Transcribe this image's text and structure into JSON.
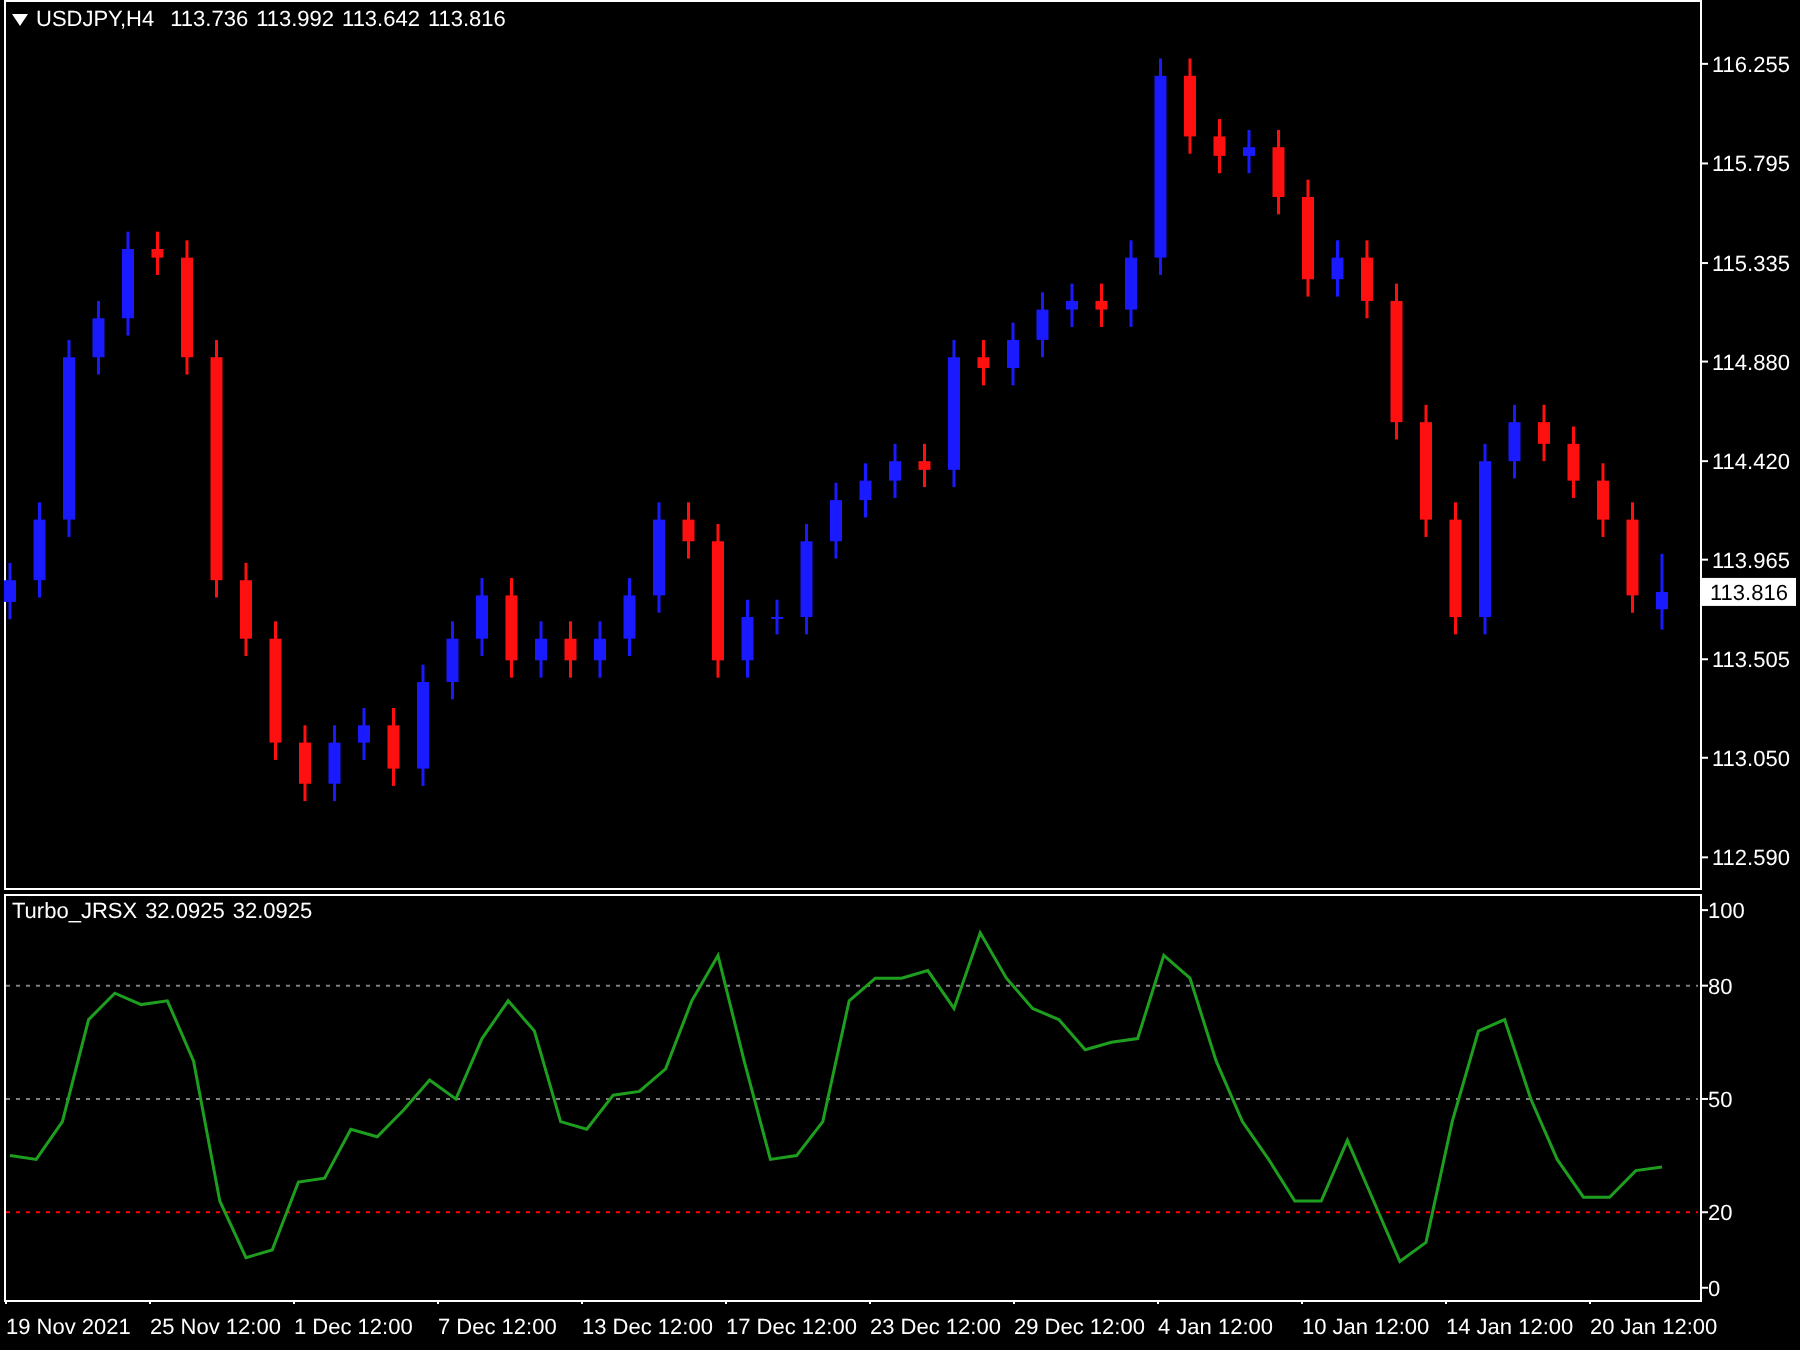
{
  "price_chart": {
    "symbol": "USDJPY,H4",
    "ohlc": [
      "113.736",
      "113.992",
      "113.642",
      "113.816"
    ],
    "current_price": "113.816",
    "chart_data": {
      "type": "candlestick",
      "categories": [
        null,
        null,
        null,
        null,
        null,
        null,
        null,
        null,
        null,
        null,
        null,
        null,
        null,
        null,
        null,
        null,
        null,
        null,
        null,
        null,
        null,
        null,
        null,
        null,
        null,
        null,
        null,
        null,
        null,
        null,
        null,
        null,
        null,
        null,
        null,
        null,
        null,
        null,
        null,
        null,
        null,
        null,
        null,
        null,
        null,
        null,
        null,
        null,
        null,
        null,
        null,
        null,
        null,
        null,
        null,
        null,
        null
      ],
      "ylim": [
        112.43,
        116.55
      ],
      "yticks": [
        {
          "value": 116.255,
          "label": "116.255"
        },
        {
          "value": 115.795,
          "label": "115.795"
        },
        {
          "value": 115.335,
          "label": "115.335"
        },
        {
          "value": 114.88,
          "label": "114.880"
        },
        {
          "value": 114.42,
          "label": "114.420"
        },
        {
          "value": 113.965,
          "label": "113.965"
        },
        {
          "value": 113.505,
          "label": "113.505"
        },
        {
          "value": 113.05,
          "label": "113.050"
        },
        {
          "value": 112.59,
          "label": "112.590"
        }
      ],
      "ohlc": [
        [
          113.77,
          113.95,
          113.69,
          113.87
        ],
        [
          113.87,
          114.23,
          113.79,
          114.15
        ],
        [
          114.15,
          114.98,
          114.07,
          114.9
        ],
        [
          114.9,
          115.16,
          114.82,
          115.08
        ],
        [
          115.08,
          115.48,
          115.0,
          115.4
        ],
        [
          115.4,
          115.48,
          115.28,
          115.36
        ],
        [
          115.36,
          115.44,
          114.82,
          114.9
        ],
        [
          114.9,
          114.98,
          113.79,
          113.87
        ],
        [
          113.87,
          113.95,
          113.52,
          113.6
        ],
        [
          113.6,
          113.68,
          113.04,
          113.12
        ],
        [
          113.12,
          113.2,
          112.85,
          112.93
        ],
        [
          112.93,
          113.2,
          112.85,
          113.12
        ],
        [
          113.12,
          113.28,
          113.04,
          113.2
        ],
        [
          113.2,
          113.28,
          112.92,
          113.0
        ],
        [
          113.0,
          113.48,
          112.92,
          113.4
        ],
        [
          113.4,
          113.68,
          113.32,
          113.6
        ],
        [
          113.6,
          113.88,
          113.52,
          113.8
        ],
        [
          113.8,
          113.88,
          113.42,
          113.5
        ],
        [
          113.5,
          113.68,
          113.42,
          113.6
        ],
        [
          113.6,
          113.68,
          113.42,
          113.5
        ],
        [
          113.5,
          113.68,
          113.42,
          113.6
        ],
        [
          113.6,
          113.88,
          113.52,
          113.8
        ],
        [
          113.8,
          114.23,
          113.72,
          114.15
        ],
        [
          114.15,
          114.23,
          113.97,
          114.05
        ],
        [
          114.05,
          114.13,
          113.42,
          113.5
        ],
        [
          113.5,
          113.78,
          113.42,
          113.7
        ],
        [
          113.7,
          113.78,
          113.62,
          113.7
        ],
        [
          113.7,
          114.13,
          113.62,
          114.05
        ],
        [
          114.05,
          114.32,
          113.97,
          114.24
        ],
        [
          114.24,
          114.41,
          114.16,
          114.33
        ],
        [
          114.33,
          114.5,
          114.25,
          114.42
        ],
        [
          114.42,
          114.5,
          114.3,
          114.38
        ],
        [
          114.38,
          114.98,
          114.3,
          114.9
        ],
        [
          114.9,
          114.98,
          114.77,
          114.85
        ],
        [
          114.85,
          115.06,
          114.77,
          114.98
        ],
        [
          114.98,
          115.2,
          114.9,
          115.12
        ],
        [
          115.12,
          115.24,
          115.04,
          115.16
        ],
        [
          115.16,
          115.24,
          115.04,
          115.12
        ],
        [
          115.12,
          115.44,
          115.04,
          115.36
        ],
        [
          115.36,
          116.28,
          115.28,
          116.2
        ],
        [
          116.2,
          116.28,
          115.84,
          115.92
        ],
        [
          115.92,
          116.0,
          115.75,
          115.83
        ],
        [
          115.83,
          115.95,
          115.75,
          115.87
        ],
        [
          115.87,
          115.95,
          115.56,
          115.64
        ],
        [
          115.64,
          115.72,
          115.18,
          115.26
        ],
        [
          115.26,
          115.44,
          115.18,
          115.36
        ],
        [
          115.36,
          115.44,
          115.08,
          115.16
        ],
        [
          115.16,
          115.24,
          114.52,
          114.6
        ],
        [
          114.6,
          114.68,
          114.07,
          114.15
        ],
        [
          114.15,
          114.23,
          113.62,
          113.7
        ],
        [
          113.7,
          114.5,
          113.62,
          114.42
        ],
        [
          114.42,
          114.68,
          114.34,
          114.6
        ],
        [
          114.6,
          114.68,
          114.42,
          114.5
        ],
        [
          114.5,
          114.58,
          114.25,
          114.33
        ],
        [
          114.33,
          114.41,
          114.07,
          114.15
        ],
        [
          114.15,
          114.23,
          113.72,
          113.8
        ],
        [
          113.736,
          113.992,
          113.642,
          113.816
        ]
      ]
    }
  },
  "indicator": {
    "name": "Turbo_JRSX",
    "readings": [
      "32.0925",
      "32.0925"
    ],
    "chart_data": {
      "type": "line",
      "ylim": [
        -4.3,
        104.8
      ],
      "yticks": [
        0,
        20,
        50,
        80,
        100
      ],
      "ref_lines": [
        {
          "axis": "y",
          "value": 80,
          "color": "#808080"
        },
        {
          "axis": "y",
          "value": 50,
          "color": "#808080"
        },
        {
          "axis": "y",
          "value": 20,
          "color": "#ff0000"
        }
      ],
      "series": [
        {
          "color": "#1e9e1e",
          "values": [
            35,
            34,
            44,
            71,
            78,
            75,
            76,
            60,
            23,
            8,
            10,
            28,
            29,
            42,
            40,
            47,
            55,
            50,
            66,
            76,
            68,
            44,
            42,
            51,
            52,
            58,
            76,
            88,
            60,
            34,
            35,
            44,
            76,
            82,
            82,
            84,
            74,
            94,
            82,
            74,
            71,
            63,
            65,
            66,
            88,
            82,
            60,
            44,
            34,
            23,
            23,
            39,
            23,
            7,
            12,
            44,
            68,
            71,
            50,
            34,
            24,
            24,
            31,
            32
          ]
        }
      ]
    }
  },
  "time_axis": {
    "labels": [
      "19 Nov 2021",
      "25 Nov 12:00",
      "1 Dec 12:00",
      "7 Dec 12:00",
      "13 Dec 12:00",
      "17 Dec 12:00",
      "23 Dec 12:00",
      "29 Dec 12:00",
      "4 Jan 12:00",
      "10 Jan 12:00",
      "14 Jan 12:00",
      "20 Jan 12:00"
    ]
  }
}
